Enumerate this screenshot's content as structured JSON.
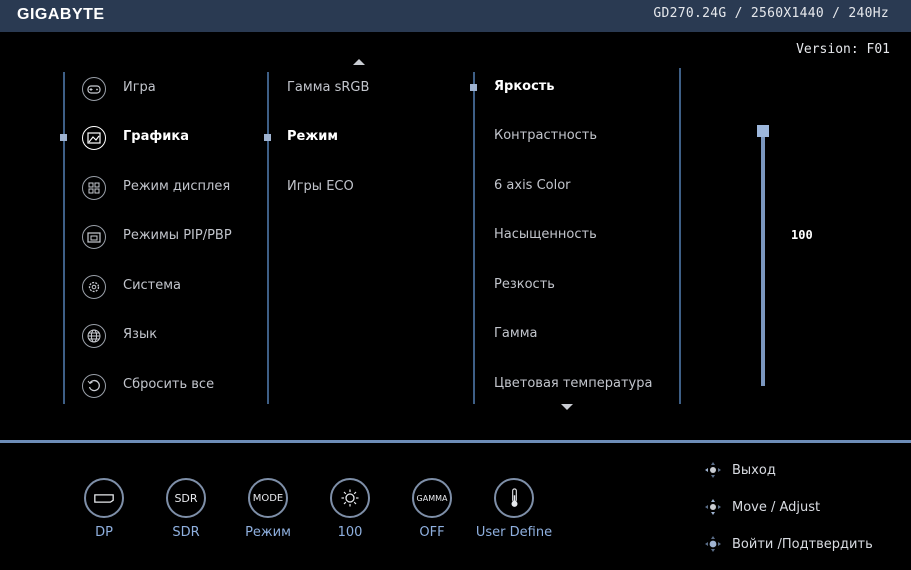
{
  "header": {
    "brand": "GIGABYTE",
    "model_info": "GD270.24G / 2560X1440 / 240Hz",
    "version": "Version: F01"
  },
  "colors": {
    "topbar": "#2a3a52",
    "accent_line": "#3e5f86",
    "active_text": "#ffffff",
    "value_label": "#8fb0df"
  },
  "menu": {
    "col1": [
      {
        "label": "Игра",
        "icon": "gamepad-icon"
      },
      {
        "label": "Графика",
        "icon": "picture-icon",
        "active": true
      },
      {
        "label": "Режим дисплея",
        "icon": "grid-icon"
      },
      {
        "label": "Режимы PIP/PBP",
        "icon": "pip-icon"
      },
      {
        "label": "Система",
        "icon": "gear-icon"
      },
      {
        "label": "Язык",
        "icon": "globe-icon"
      },
      {
        "label": "Сбросить все",
        "icon": "reset-icon"
      }
    ],
    "col2": [
      {
        "label": "Гамма sRGB"
      },
      {
        "label": "Режим",
        "active": true
      },
      {
        "label": "Игры ECO"
      }
    ],
    "col3": [
      {
        "label": "Яркость",
        "active": true
      },
      {
        "label": "Контрастность"
      },
      {
        "label": "6 axis Color"
      },
      {
        "label": "Насыщенность"
      },
      {
        "label": "Резкость"
      },
      {
        "label": "Гамма"
      },
      {
        "label": "Цветовая температура"
      }
    ]
  },
  "slider": {
    "value_text": "100",
    "level": 1.0
  },
  "quick_bar": [
    {
      "icon": "displayport-icon",
      "label": "DP"
    },
    {
      "icon": "sdr-icon",
      "icon_text": "SDR",
      "label": "SDR"
    },
    {
      "icon": "mode-icon",
      "icon_text": "MODE",
      "label": "Режим"
    },
    {
      "icon": "brightness-icon",
      "label": "100"
    },
    {
      "icon": "gamma-icon",
      "icon_text": "GAMMA",
      "label": "OFF"
    },
    {
      "icon": "thermometer-icon",
      "label": "User Define"
    }
  ],
  "nav_hints": [
    {
      "icon": "dpad-left-icon",
      "label": "Выход"
    },
    {
      "icon": "dpad-updown-icon",
      "label": "Move / Adjust"
    },
    {
      "icon": "dpad-press-icon",
      "label": "Войти /Подтвердить"
    }
  ]
}
